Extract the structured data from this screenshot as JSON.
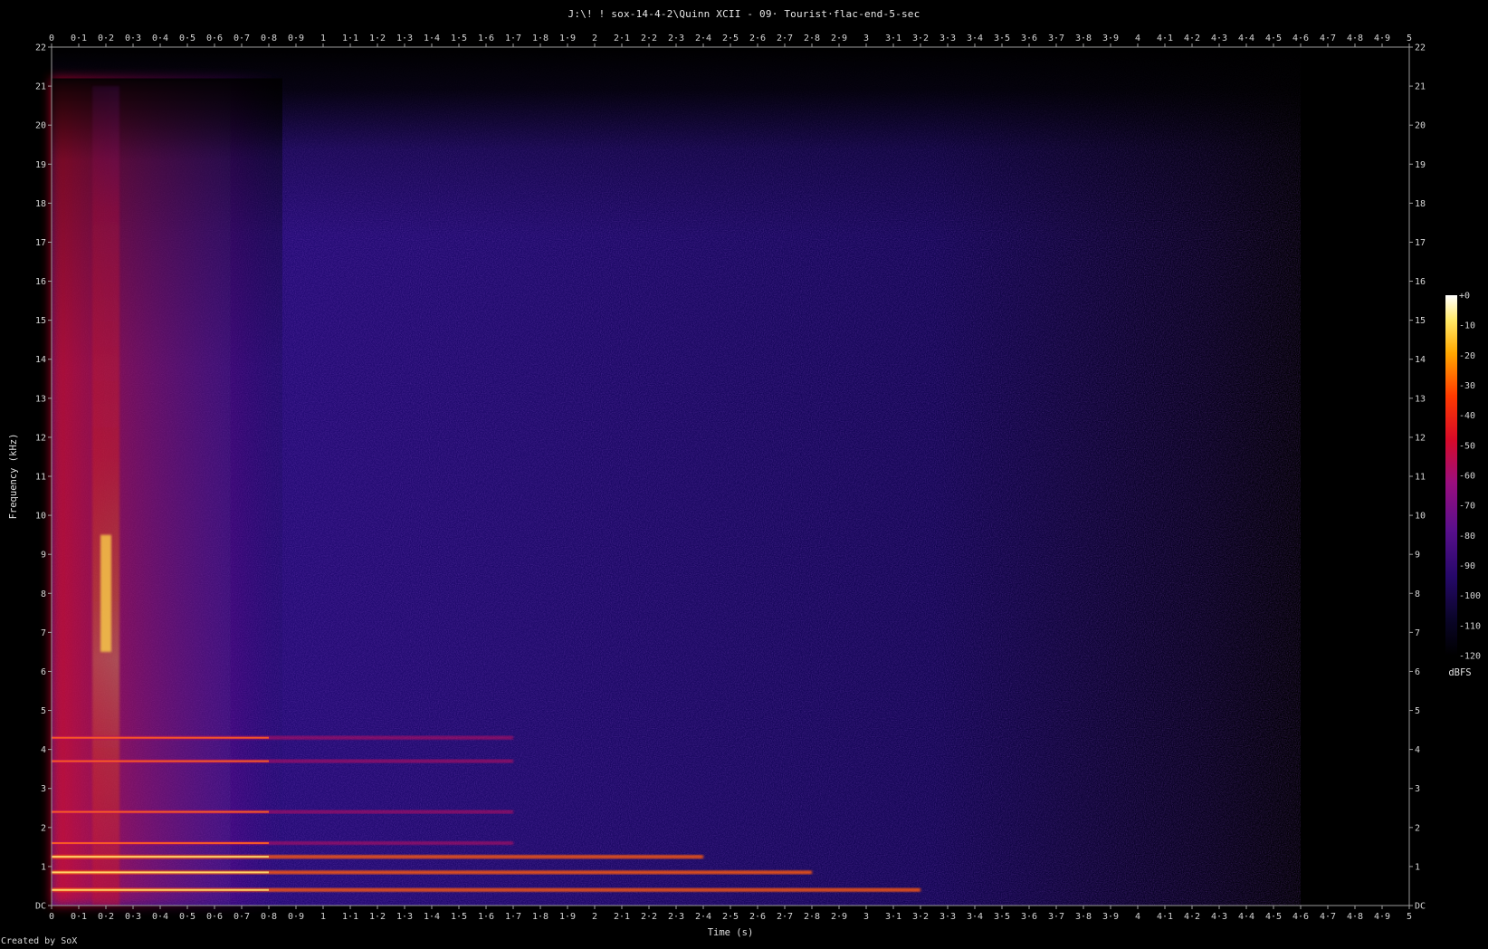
{
  "window": {
    "title": "J:\\! ! sox-14-4-2\\Quinn XCII - 09· Tourist·flac-end-5-sec",
    "credit": "Created by SoX"
  },
  "chart_data": {
    "type": "heatmap",
    "title": "J:\\! ! sox-14-4-2\\Quinn XCII - 09· Tourist·flac-end-5-sec",
    "xlabel": "Time (s)",
    "ylabel": "Frequency (kHz)",
    "xlim": [
      0,
      5
    ],
    "ylim": [
      0,
      22
    ],
    "x_tick_labels": [
      "0",
      "0·1",
      "0·2",
      "0·3",
      "0·4",
      "0·5",
      "0·6",
      "0·7",
      "0·8",
      "0·9",
      "1",
      "1·1",
      "1·2",
      "1·3",
      "1·4",
      "1·5",
      "1·6",
      "1·7",
      "1·8",
      "1·9",
      "2",
      "2·1",
      "2·2",
      "2·3",
      "2·4",
      "2·5",
      "2·6",
      "2·7",
      "2·8",
      "2·9",
      "3",
      "3·1",
      "3·2",
      "3·3",
      "3·4",
      "3·5",
      "3·6",
      "3·7",
      "3·8",
      "3·9",
      "4",
      "4·1",
      "4·2",
      "4·3",
      "4·4",
      "4·5",
      "4·6",
      "4·7",
      "4·8",
      "4·9",
      "5"
    ],
    "y_tick_labels": [
      "DC",
      "1",
      "2",
      "3",
      "4",
      "5",
      "6",
      "7",
      "8",
      "9",
      "10",
      "11",
      "12",
      "13",
      "14",
      "15",
      "16",
      "17",
      "18",
      "19",
      "20",
      "21",
      "22"
    ],
    "colorbar": {
      "label": "dBFS",
      "tick_labels": [
        "+0",
        "-10",
        "-20",
        "-30",
        "-40",
        "-50",
        "-60",
        "-70",
        "-80",
        "-90",
        "-100",
        "-110",
        "-120"
      ],
      "range": [
        -120,
        0
      ]
    },
    "features": {
      "broadband_burst": {
        "time_range": [
          0.15,
          0.25
        ],
        "freq_range_khz": [
          0,
          21
        ],
        "peak_khz": [
          6.5,
          9.5
        ],
        "level_db": -15
      },
      "early_energy": {
        "time_range": [
          0,
          0.85
        ],
        "level_db": -55
      },
      "harmonic_bands_khz": [
        0.4,
        0.85,
        1.25,
        1.6,
        2.4,
        3.7,
        4.3
      ],
      "noise_floor_db": -95,
      "decay_end_s": 4.6
    }
  }
}
